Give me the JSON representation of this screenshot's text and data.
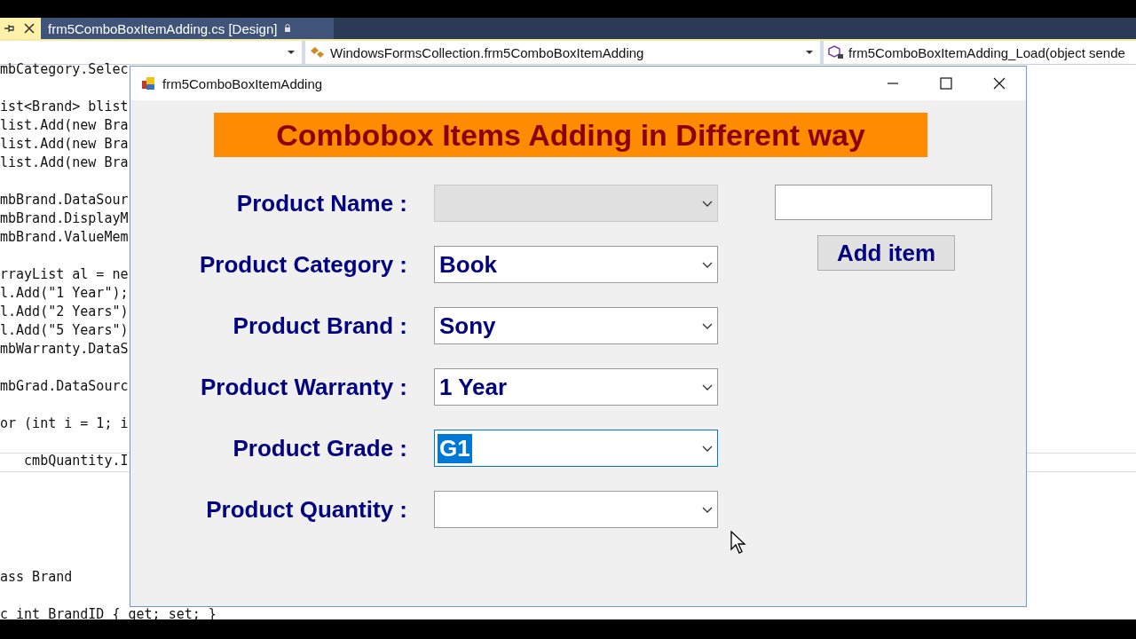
{
  "editor_tab": {
    "title": "frm5ComboBoxItemAdding.cs [Design]"
  },
  "navigation_bar": {
    "class_dropdown": "WindowsFormsCollection.frm5ComboBoxItemAdding",
    "member_dropdown": "frm5ComboBoxItemAdding_Load(object sende"
  },
  "code_upper": [
    [
      "mbCategory.Selec"
    ],
    [
      "ist<Brand> blist",
      "list.Add(new Bra",
      "list.Add(new Bra",
      "list.Add(new Bra"
    ],
    [
      "mbBrand.DataSour",
      "mbBrand.DisplayM",
      "mbBrand.ValueMem"
    ],
    [
      "rrayList al = ne",
      "l.Add(\"1 Year\");",
      "l.Add(\"2 Years\")",
      "l.Add(\"5 Years\")",
      "mbWarranty.DataS"
    ],
    [
      "mbGrad.DataSourc"
    ],
    [
      "or (int i = 1; i"
    ],
    [
      "   cmbQuantity.I"
    ]
  ],
  "code_lower": [
    [
      "ass Brand"
    ],
    [
      "c int BrandID { get; set; }"
    ]
  ],
  "window": {
    "title": "frm5ComboBoxItemAdding",
    "banner": "Combobox Items Adding in Different way",
    "fields": [
      {
        "label": "Product Name :",
        "disabled": true,
        "focused": false
      },
      {
        "label": "Product Category :",
        "value": "Book",
        "disabled": false,
        "focused": false
      },
      {
        "label": "Product Brand :",
        "value": "Sony",
        "disabled": false,
        "focused": false
      },
      {
        "label": "Product Warranty :",
        "value": "1 Year",
        "disabled": false,
        "focused": false
      },
      {
        "label": "Product Grade :",
        "value": "G1",
        "disabled": false,
        "focused": true
      },
      {
        "label": "Product Quantity :",
        "disabled": false,
        "focused": false
      }
    ],
    "add_button": "Add item"
  }
}
